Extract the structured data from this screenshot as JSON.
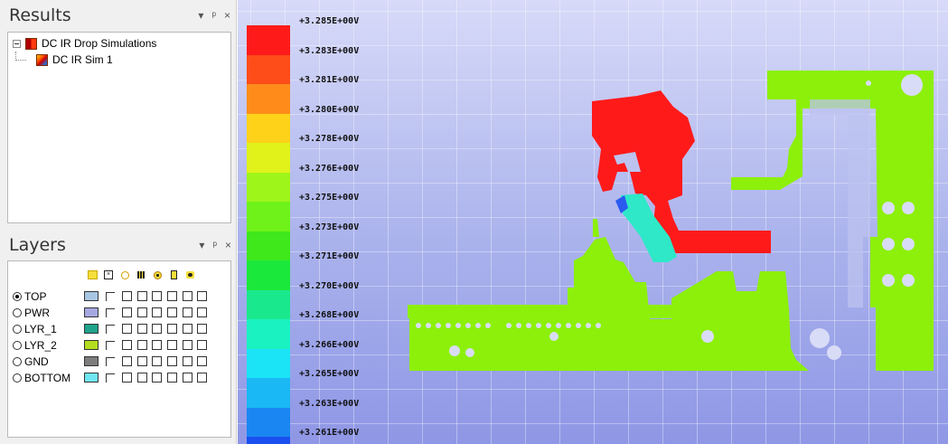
{
  "results": {
    "title": "Results",
    "controls": [
      "▾",
      "ᵖ",
      "×"
    ],
    "tree": {
      "root_label": "DC IR Drop Simulations",
      "child_label": "DC IR Sim 1"
    }
  },
  "layers": {
    "title": "Layers",
    "controls": [
      "▾",
      "ᵖ",
      "×"
    ],
    "column_icons": [
      "trace-icon",
      "fill-icon",
      "via-icon",
      "pin-icon",
      "pad-icon",
      "hole-icon",
      "component-icon"
    ],
    "rows": [
      {
        "name": "TOP",
        "color": "#a8c6e4",
        "selected": true
      },
      {
        "name": "PWR",
        "color": "#a6a8e0",
        "selected": false
      },
      {
        "name": "LYR_1",
        "color": "#1fa38b",
        "selected": false
      },
      {
        "name": "LYR_2",
        "color": "#b3dd1e",
        "selected": false
      },
      {
        "name": "GND",
        "color": "#7d7d7d",
        "selected": false
      },
      {
        "name": "BOTTOM",
        "color": "#6fe6f2",
        "selected": false
      }
    ]
  },
  "legend": {
    "labels": [
      "+3.285E+00V",
      "+3.283E+00V",
      "+3.281E+00V",
      "+3.280E+00V",
      "+3.278E+00V",
      "+3.276E+00V",
      "+3.275E+00V",
      "+3.273E+00V",
      "+3.271E+00V",
      "+3.270E+00V",
      "+3.268E+00V",
      "+3.266E+00V",
      "+3.265E+00V",
      "+3.263E+00V",
      "+3.261E+00V"
    ],
    "colors": [
      "#ff1a1a",
      "#ff4d1a",
      "#ff8c1a",
      "#ffd21a",
      "#e0f21a",
      "#9ef51a",
      "#6ef21a",
      "#3ee81a",
      "#1ae83a",
      "#1ae88c",
      "#1af2c2",
      "#1ae4f5",
      "#1ab8f5",
      "#1a86f2",
      "#1a50f0"
    ]
  },
  "voltage_map": {
    "colors": {
      "main": "#8cf00a",
      "hot": "#ff1a1a",
      "cool": "#2ee8c8",
      "blue": "#2a5af0"
    }
  }
}
